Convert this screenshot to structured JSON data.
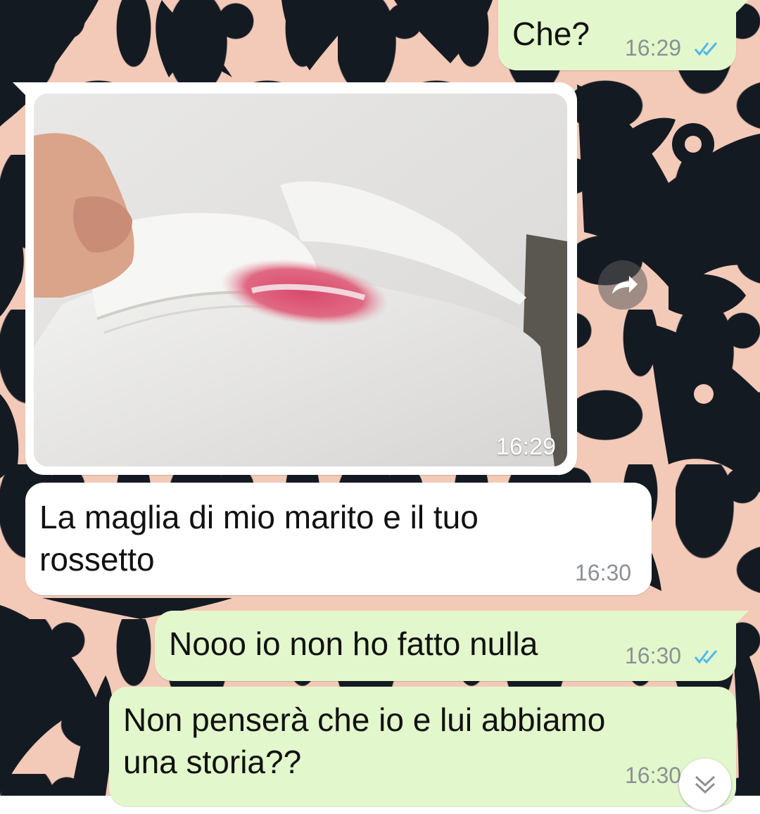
{
  "messages": [
    {
      "direction": "outgoing",
      "text": "Che?",
      "time": "16:29",
      "status": "read"
    },
    {
      "direction": "incoming",
      "type": "image",
      "image_description_icon": "photo-lipstick-shirt",
      "time": "16:29"
    },
    {
      "direction": "incoming",
      "text_line1": "La maglia di mio marito e il tuo",
      "text_line2": "rossetto",
      "time": "16:30"
    },
    {
      "direction": "outgoing",
      "text": "Nooo io non ho fatto nulla",
      "time": "16:30",
      "status": "read"
    },
    {
      "direction": "outgoing",
      "text_line1": "Non penserà che io e lui abbiamo",
      "text_line2": "una storia??",
      "time": "16:30",
      "status": "read"
    }
  ],
  "colors": {
    "outgoing_bubble": "#e2f7cb",
    "incoming_bubble": "#ffffff",
    "read_ticks": "#4fb6ec",
    "timestamp": "#8c9096",
    "wallpaper_light": "#f3c9b8",
    "wallpaper_dark": "#141a22"
  },
  "icons": {
    "forward": "forward-arrow-icon",
    "scroll_down": "double-chevron-down-icon",
    "read": "double-check-icon"
  }
}
